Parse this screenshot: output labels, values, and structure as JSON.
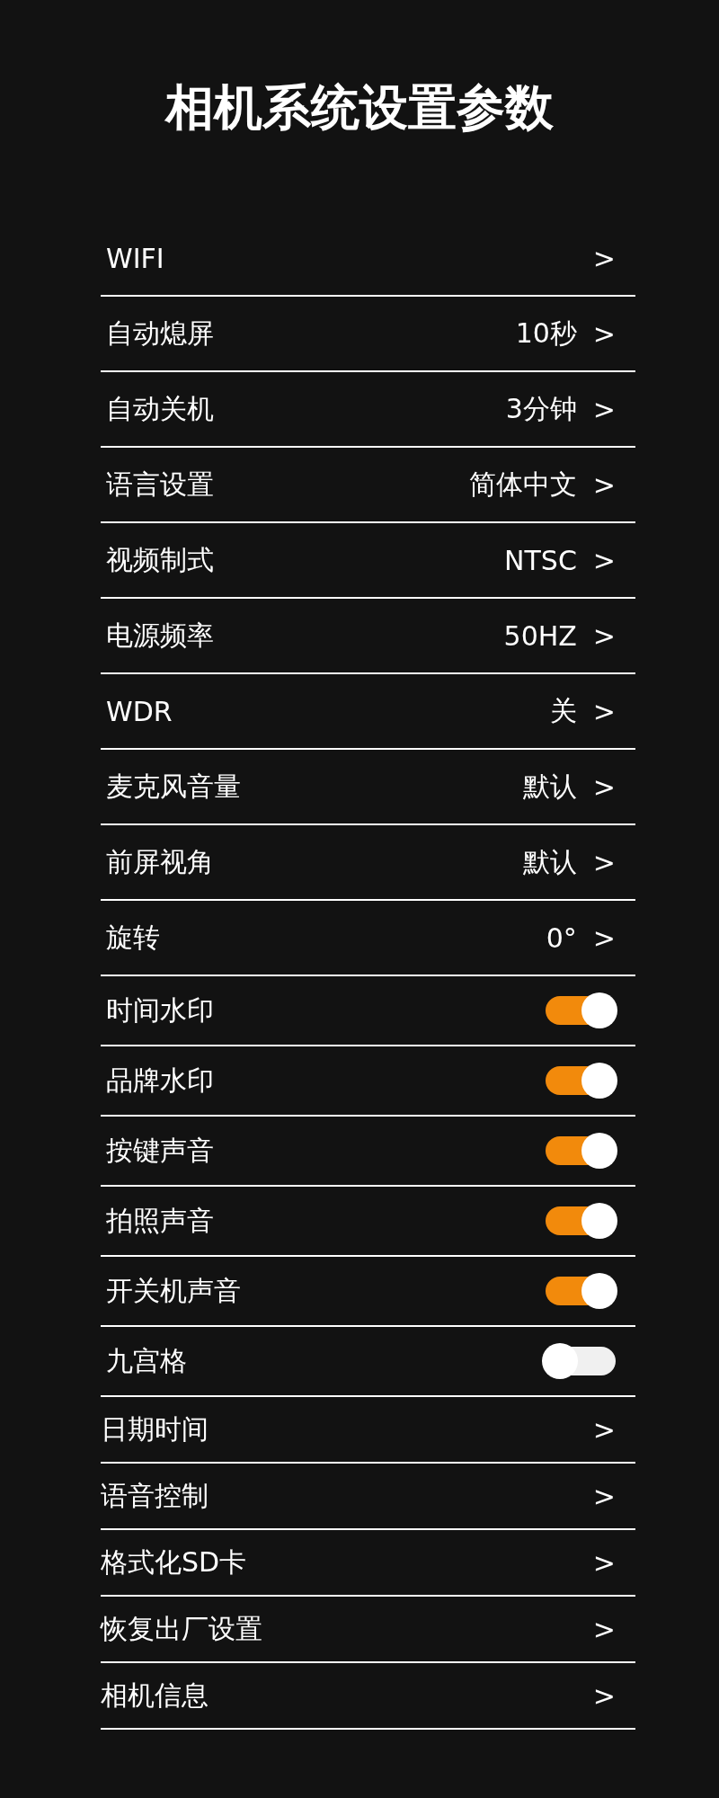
{
  "title": "相机系统设置参数",
  "items": [
    {
      "kind": "nav",
      "label": "WIFI",
      "arrow": ">"
    },
    {
      "kind": "nav",
      "label": "自动熄屏",
      "value": "10秒",
      "arrow": ">"
    },
    {
      "kind": "nav",
      "label": "自动关机",
      "value": "3分钟",
      "arrow": ">"
    },
    {
      "kind": "nav",
      "label": "语言设置",
      "value": "简体中文",
      "arrow": ">"
    },
    {
      "kind": "nav",
      "label": "视频制式",
      "value": "NTSC",
      "arrow": ">"
    },
    {
      "kind": "nav",
      "label": "电源频率",
      "value": "50HZ",
      "arrow": ">"
    },
    {
      "kind": "nav",
      "label": "WDR",
      "value": "关",
      "arrow": ">"
    },
    {
      "kind": "nav",
      "label": "麦克风音量",
      "value": "默认",
      "arrow": ">"
    },
    {
      "kind": "nav",
      "label": "前屏视角",
      "value": "默认",
      "arrow": ">"
    },
    {
      "kind": "nav",
      "label": "旋转",
      "value": "0°",
      "arrow": ">"
    },
    {
      "kind": "toggle",
      "label": "时间水印",
      "on": true
    },
    {
      "kind": "toggle",
      "label": "品牌水印",
      "on": true
    },
    {
      "kind": "toggle",
      "label": "按键声音",
      "on": true
    },
    {
      "kind": "toggle",
      "label": "拍照声音",
      "on": true
    },
    {
      "kind": "toggle",
      "label": "开关机声音",
      "on": true
    },
    {
      "kind": "toggle",
      "label": "九宫格",
      "on": false
    },
    {
      "kind": "link",
      "label": "日期时间",
      "arrow": ">"
    },
    {
      "kind": "link",
      "label": "语音控制",
      "arrow": ">"
    },
    {
      "kind": "link",
      "label": "格式化SD卡",
      "arrow": ">"
    },
    {
      "kind": "link",
      "label": "恢复出厂设置",
      "arrow": ">"
    },
    {
      "kind": "link",
      "label": "相机信息",
      "arrow": ">"
    }
  ]
}
